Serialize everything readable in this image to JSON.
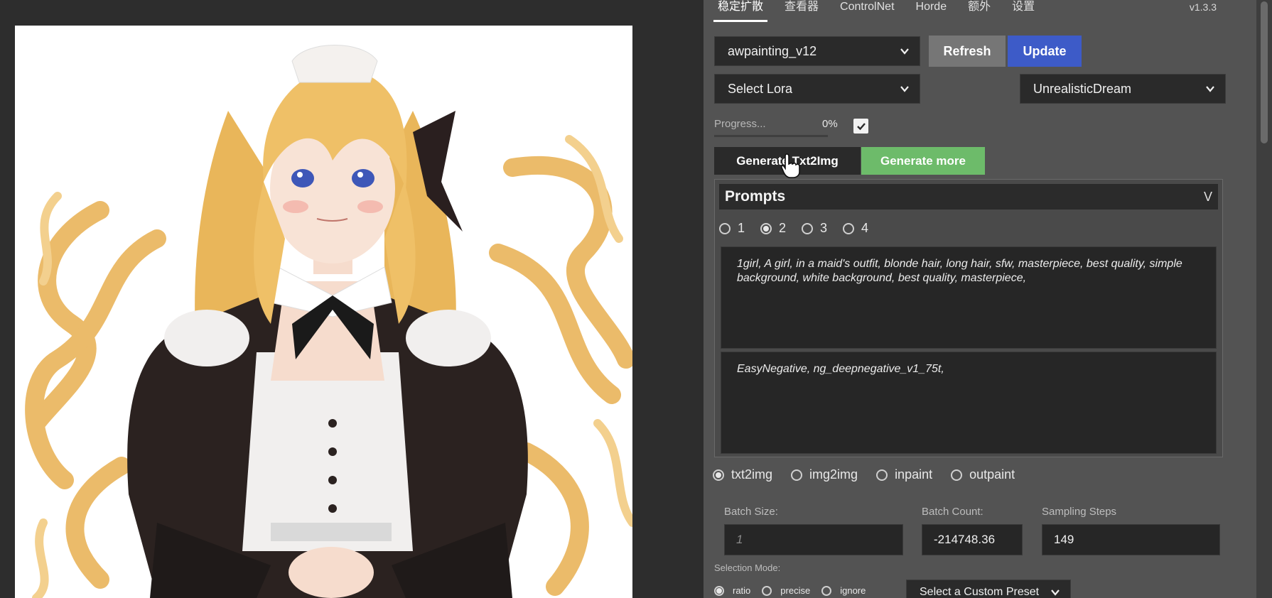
{
  "tabs": [
    "稳定扩散",
    "查看器",
    "ControlNet",
    "Horde",
    "额外",
    "设置"
  ],
  "version": "v1.3.3",
  "model_dropdown": {
    "value": "awpainting_v12"
  },
  "lora_dropdown": {
    "value": "Select Lora"
  },
  "style_dropdown": {
    "value": "UnrealisticDream"
  },
  "refresh_label": "Refresh",
  "update_label": "Update",
  "progress": {
    "label": "Progress...",
    "value": "0%",
    "fraction": 0,
    "checkbox_checked": true
  },
  "generate_txt2img_label": "Generate Txt2Img",
  "generate_more_label": "Generate more",
  "prompts": {
    "title": "Prompts",
    "toggle": "V",
    "options": [
      "1",
      "2",
      "3",
      "4"
    ],
    "selected": "2",
    "positive": "1girl, A girl, in a maid's outfit, blonde hair, long hair, sfw, masterpiece, best quality, simple background, white background, best quality, masterpiece,",
    "negative": "EasyNegative, ng_deepnegative_v1_75t,"
  },
  "modes": {
    "options": [
      "txt2img",
      "img2img",
      "inpaint",
      "outpaint"
    ],
    "selected": "txt2img"
  },
  "fields": {
    "batch_size": {
      "label": "Batch Size:",
      "placeholder": "1"
    },
    "batch_count": {
      "label": "Batch Count:",
      "value": "-214748.36"
    },
    "sampling_steps": {
      "label": "Sampling Steps",
      "value": "149"
    }
  },
  "selection_mode": {
    "label": "Selection Mode:",
    "options": [
      "ratio",
      "precise",
      "ignore"
    ],
    "selected": "ratio",
    "preset": "Select a Custom Preset"
  },
  "colors": {
    "panel_bg": "#535353",
    "update_button": "#3d5bc8",
    "refresh_button": "#767676",
    "generate_more": "#6dbb6a",
    "field_bg": "#262626"
  },
  "icons": {
    "chevron": "chevron-down-icon",
    "cursor": "hand-pointer-icon",
    "checkbox": "checkmark-icon"
  }
}
